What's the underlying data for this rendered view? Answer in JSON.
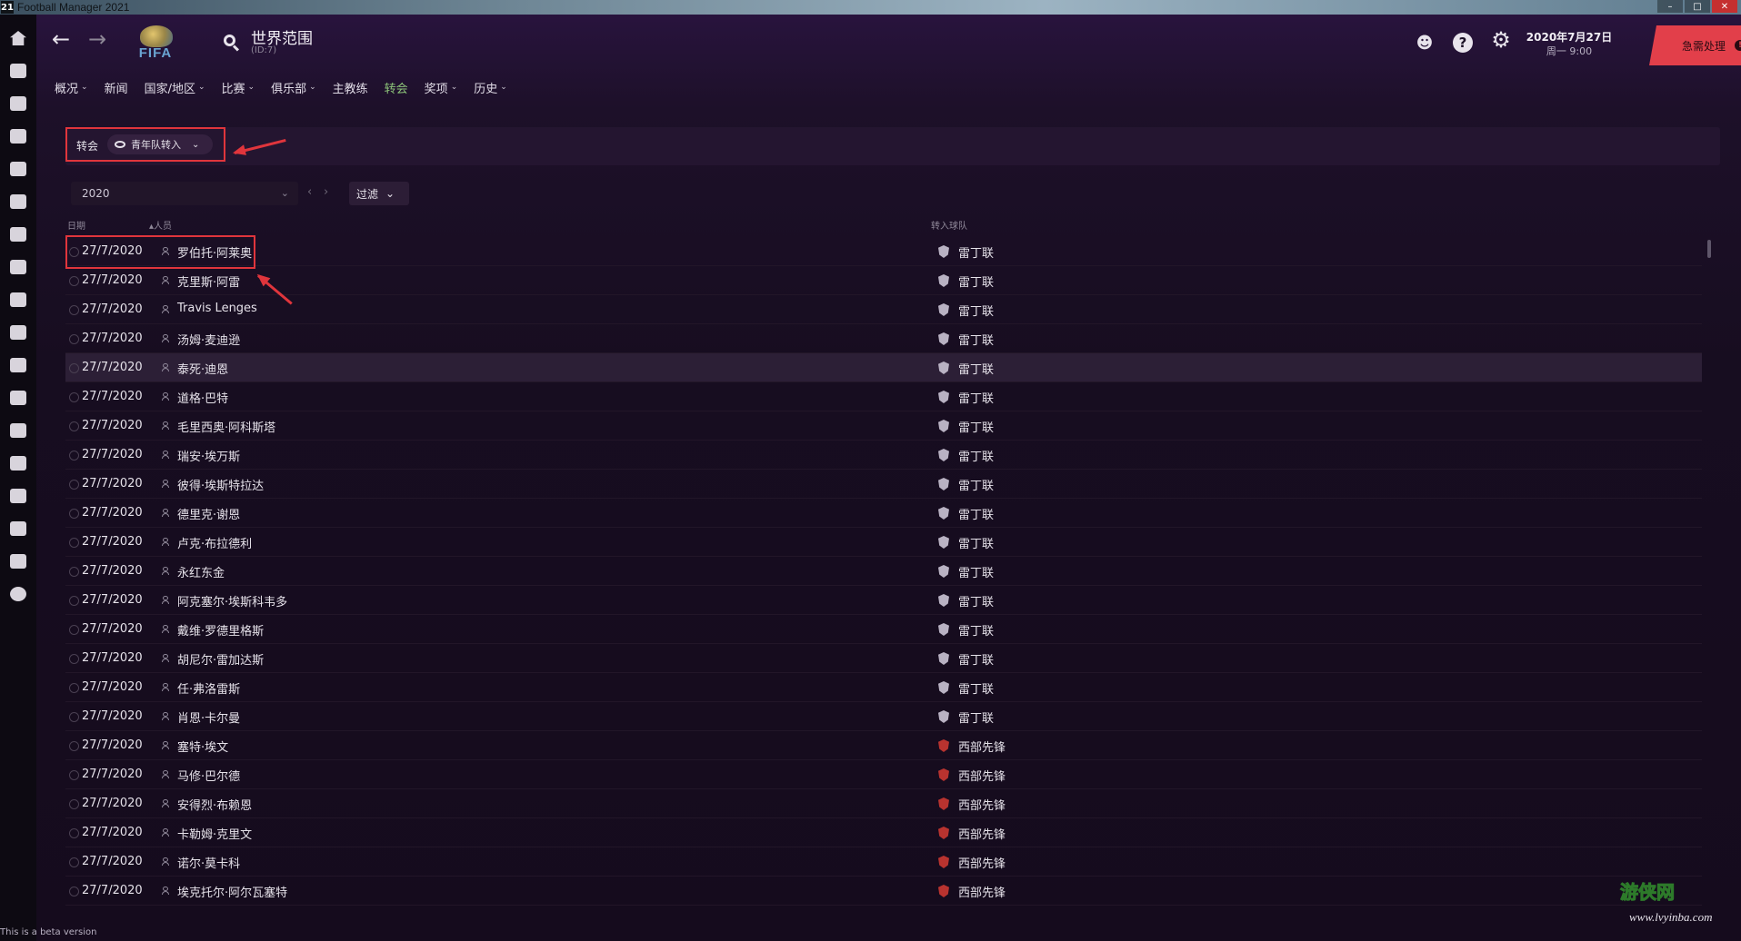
{
  "window": {
    "badge": "21",
    "title": "Football Manager 2021",
    "controls": [
      "–",
      "□",
      "✕"
    ]
  },
  "leftnav": [
    {
      "icon": "home-icon"
    },
    {
      "icon": "inbox-icon"
    },
    {
      "icon": "shirt-icon"
    },
    {
      "icon": "tactics-icon"
    },
    {
      "icon": "data-icon"
    },
    {
      "icon": "report-icon"
    },
    {
      "icon": "staff-icon"
    },
    {
      "icon": "training-icon"
    },
    {
      "icon": "medical-icon"
    },
    {
      "icon": "calendar-icon"
    },
    {
      "icon": "trophy-icon"
    },
    {
      "icon": "scouting-icon"
    },
    {
      "icon": "transfers-icon"
    },
    {
      "icon": "club-icon"
    },
    {
      "icon": "finances-icon"
    },
    {
      "icon": "dev-centre-icon"
    },
    {
      "icon": "stats-icon"
    },
    {
      "icon": "alert-icon"
    }
  ],
  "header": {
    "back": "←",
    "forward": "→",
    "logo_text": "FIFA",
    "title": "世界范围",
    "subtitle": "(ID:7)",
    "date_line1": "2020年7月27日",
    "date_line2": "周一 9:00",
    "urgent_label": "急需处理",
    "urgent_badge": "!",
    "help": "?",
    "settings": "⚙",
    "social": "☻"
  },
  "tabs": [
    {
      "label": "概况",
      "dropdown": true
    },
    {
      "label": "新闻",
      "dropdown": false
    },
    {
      "label": "国家/地区",
      "dropdown": true
    },
    {
      "label": "比赛",
      "dropdown": true
    },
    {
      "label": "俱乐部",
      "dropdown": true
    },
    {
      "label": "主教练",
      "dropdown": false
    },
    {
      "label": "转会",
      "dropdown": false,
      "active": true
    },
    {
      "label": "奖项",
      "dropdown": true
    },
    {
      "label": "历史",
      "dropdown": true
    }
  ],
  "subheader": {
    "label": "转会",
    "view": "青年队转入"
  },
  "filters": {
    "year": "2020",
    "prev": "‹",
    "next": "›",
    "filter_label": "过滤"
  },
  "table": {
    "col_date": "日期",
    "col_person": "▴人员",
    "col_club": "转入球队",
    "rows": [
      {
        "date": "27/7/2020",
        "name": "罗伯托·阿莱奥",
        "club": "雷丁联",
        "club_color": "#b9b2c3"
      },
      {
        "date": "27/7/2020",
        "name": "克里斯·阿雷",
        "club": "雷丁联",
        "club_color": "#b9b2c3"
      },
      {
        "date": "27/7/2020",
        "name": "Travis Lenges",
        "club": "雷丁联",
        "club_color": "#b9b2c3"
      },
      {
        "date": "27/7/2020",
        "name": "汤姆·麦迪逊",
        "club": "雷丁联",
        "club_color": "#b9b2c3"
      },
      {
        "date": "27/7/2020",
        "name": "泰死·迪恩",
        "club": "雷丁联",
        "club_color": "#b9b2c3"
      },
      {
        "date": "27/7/2020",
        "name": "道格·巴特",
        "club": "雷丁联",
        "club_color": "#b9b2c3"
      },
      {
        "date": "27/7/2020",
        "name": "毛里西奥·阿科斯塔",
        "club": "雷丁联",
        "club_color": "#b9b2c3"
      },
      {
        "date": "27/7/2020",
        "name": "瑞安·埃万斯",
        "club": "雷丁联",
        "club_color": "#b9b2c3"
      },
      {
        "date": "27/7/2020",
        "name": "彼得·埃斯特拉达",
        "club": "雷丁联",
        "club_color": "#b9b2c3"
      },
      {
        "date": "27/7/2020",
        "name": "德里克·谢恩",
        "club": "雷丁联",
        "club_color": "#b9b2c3"
      },
      {
        "date": "27/7/2020",
        "name": "卢克·布拉德利",
        "club": "雷丁联",
        "club_color": "#b9b2c3"
      },
      {
        "date": "27/7/2020",
        "name": "永红东金",
        "club": "雷丁联",
        "club_color": "#b9b2c3"
      },
      {
        "date": "27/7/2020",
        "name": "阿克塞尔·埃斯科韦多",
        "club": "雷丁联",
        "club_color": "#b9b2c3"
      },
      {
        "date": "27/7/2020",
        "name": "戴维·罗德里格斯",
        "club": "雷丁联",
        "club_color": "#b9b2c3"
      },
      {
        "date": "27/7/2020",
        "name": "胡尼尔·雷加达斯",
        "club": "雷丁联",
        "club_color": "#b9b2c3"
      },
      {
        "date": "27/7/2020",
        "name": "任·弗洛雷斯",
        "club": "雷丁联",
        "club_color": "#b9b2c3"
      },
      {
        "date": "27/7/2020",
        "name": "肖恩·卡尔曼",
        "club": "雷丁联",
        "club_color": "#b9b2c3"
      },
      {
        "date": "27/7/2020",
        "name": "塞特·埃文",
        "club": "西部先锋",
        "club_color": "#b8332f"
      },
      {
        "date": "27/7/2020",
        "name": "马修·巴尔德",
        "club": "西部先锋",
        "club_color": "#b8332f"
      },
      {
        "date": "27/7/2020",
        "name": "安得烈·布赖恩",
        "club": "西部先锋",
        "club_color": "#b8332f"
      },
      {
        "date": "27/7/2020",
        "name": "卡勒姆·克里文",
        "club": "西部先锋",
        "club_color": "#b8332f"
      },
      {
        "date": "27/7/2020",
        "name": "诺尔·莫卡科",
        "club": "西部先锋",
        "club_color": "#b8332f"
      },
      {
        "date": "27/7/2020",
        "name": "埃克托尔·阿尔瓦塞特",
        "club": "西部先锋",
        "club_color": "#b8332f"
      }
    ]
  },
  "footer": {
    "beta": "This is a beta version",
    "watermark_top": "游侠网",
    "watermark_bottom": "www.lvyinba.com"
  },
  "colors": {
    "accent_red": "#e0353c",
    "active_tab": "#8ec67a",
    "urgent": "#e23f4a"
  }
}
